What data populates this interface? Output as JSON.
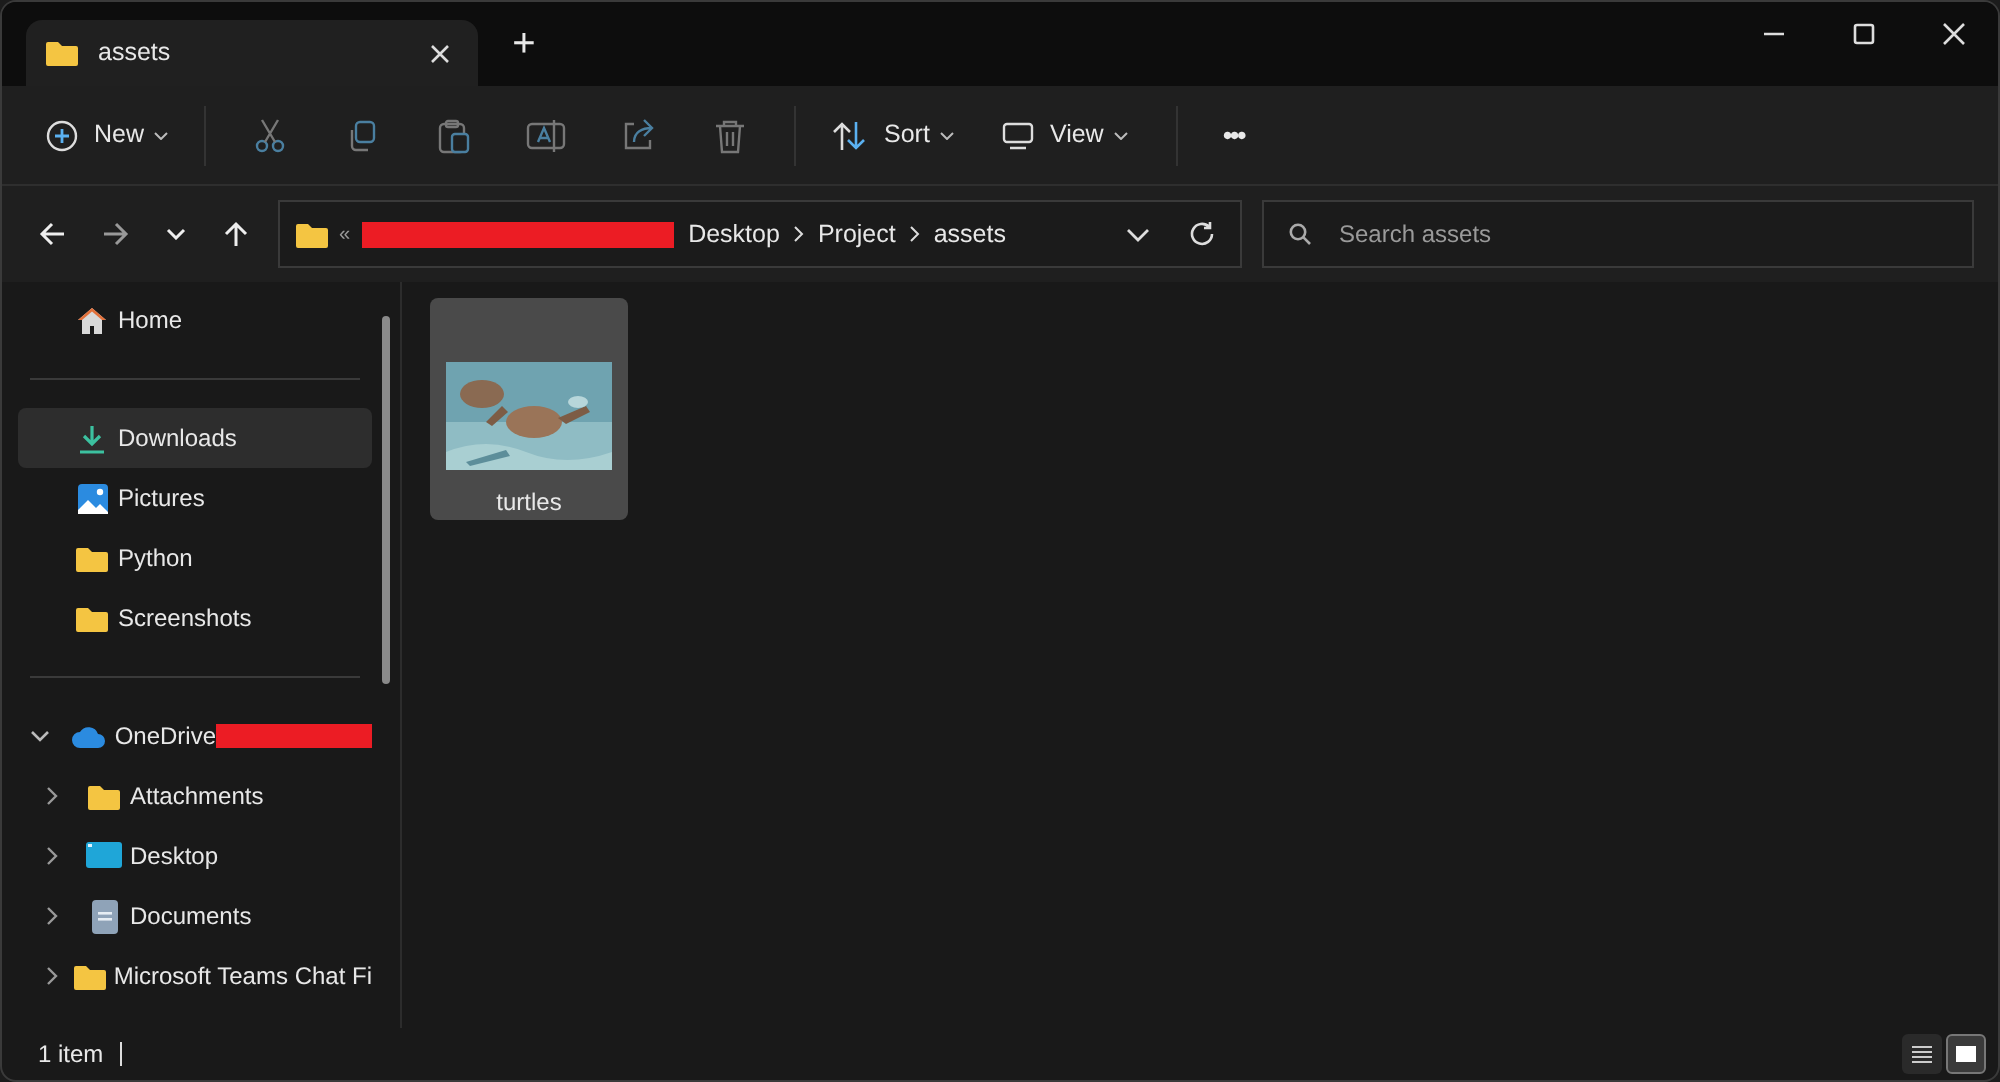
{
  "tabs": [
    {
      "label": "assets",
      "selected": true
    }
  ],
  "new_tab": "+",
  "toolbar": [
    {
      "kind": "new",
      "label": "New"
    },
    {
      "kind": "cut"
    },
    {
      "kind": "copy"
    },
    {
      "kind": "paste"
    },
    {
      "kind": "rename"
    },
    {
      "kind": "share"
    },
    {
      "kind": "delete"
    },
    {
      "kind": "sort",
      "label": "Sort"
    },
    {
      "kind": "view",
      "label": "View"
    },
    {
      "kind": "more",
      "label": "•••"
    }
  ],
  "address": {
    "prefix": "«",
    "crumbs": [
      "Desktop",
      "Project",
      "assets"
    ]
  },
  "search": {
    "placeholder": "Search assets"
  },
  "sidebar": {
    "items": [
      {
        "label": "Home",
        "kind": "home",
        "selected": false
      },
      {
        "kind": "divider"
      },
      {
        "label": "Downloads",
        "kind": "download",
        "selected": true
      },
      {
        "label": "Pictures",
        "kind": "pictures",
        "selected": false
      },
      {
        "label": "Python",
        "kind": "folder",
        "selected": false
      },
      {
        "label": "Screenshots",
        "kind": "folder",
        "selected": false
      },
      {
        "kind": "divider"
      },
      {
        "label": "OneDrive",
        "kind": "cloud",
        "selected": false,
        "expanded": true,
        "children": [
          {
            "label": "Attachments",
            "kind": "folder",
            "selected": false,
            "expanded": false
          },
          {
            "label": "Desktop",
            "kind": "desktop",
            "selected": false,
            "expanded": false
          },
          {
            "label": "Documents",
            "kind": "document",
            "selected": false,
            "expanded": false
          },
          {
            "label": "Microsoft Teams Chat Fi",
            "kind": "folder",
            "selected": false,
            "expanded": false
          }
        ]
      }
    ]
  },
  "files": [
    {
      "name": "turtles",
      "kind": "picture",
      "selected": true
    }
  ],
  "status_bar": {
    "text": "1 item",
    "views": [
      {
        "kind": "details",
        "selected": false
      },
      {
        "kind": "tiles",
        "selected": true
      }
    ]
  }
}
